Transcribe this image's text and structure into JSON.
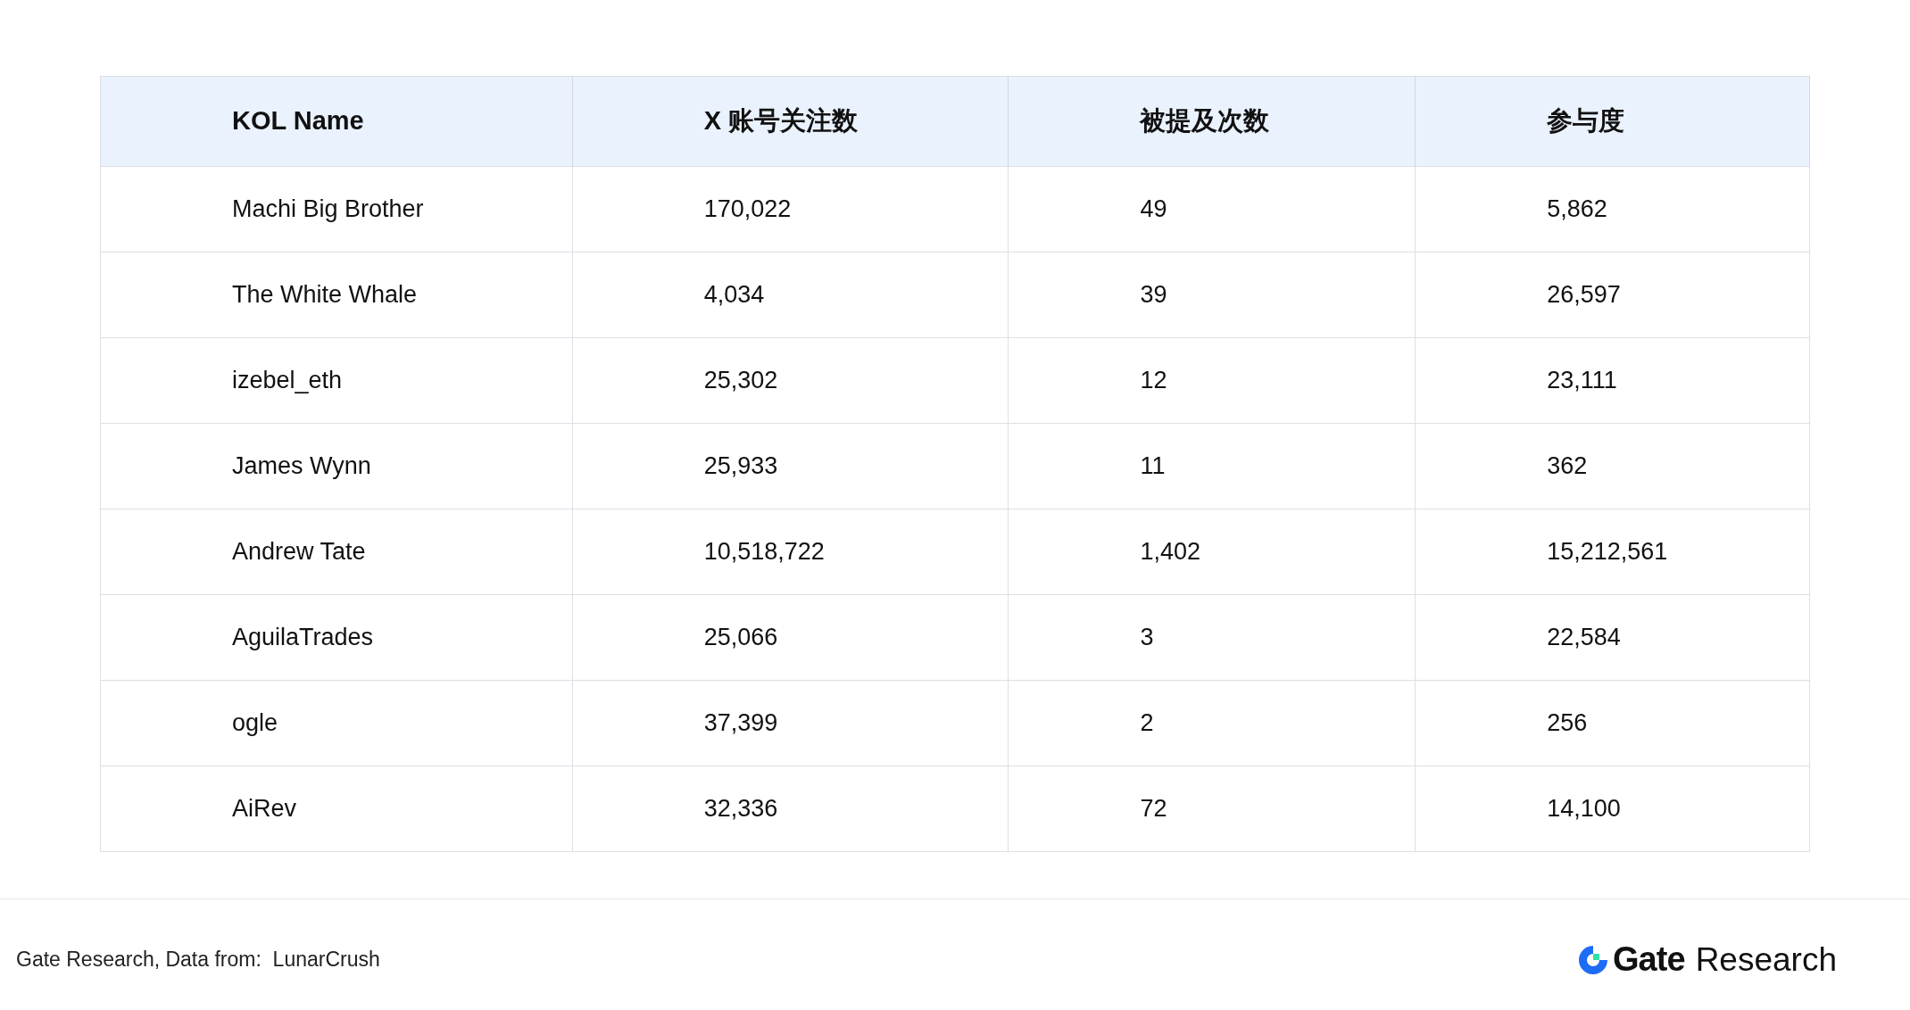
{
  "table": {
    "columns": [
      "KOL Name",
      "X 账号关注数",
      "被提及次数",
      "参与度"
    ],
    "rows": [
      [
        "Machi Big Brother",
        "170,022",
        "49",
        "5,862"
      ],
      [
        "The White Whale",
        "4,034",
        "39",
        "26,597"
      ],
      [
        "izebel_eth",
        "25,302",
        "12",
        "23,111"
      ],
      [
        "James Wynn",
        "25,933",
        "11",
        "362"
      ],
      [
        "Andrew Tate",
        "10,518,722",
        "1,402",
        "15,212,561"
      ],
      [
        "AguilaTrades",
        "25,066",
        "3",
        "22,584"
      ],
      [
        "ogle",
        "37,399",
        "2",
        "256"
      ],
      [
        "AiRev",
        "32,336",
        "72",
        "14,100"
      ]
    ]
  },
  "footer": {
    "source": "Gate Research, Data from:  LunarCrush",
    "logo_brand": "Gate",
    "logo_suffix": "Research"
  }
}
